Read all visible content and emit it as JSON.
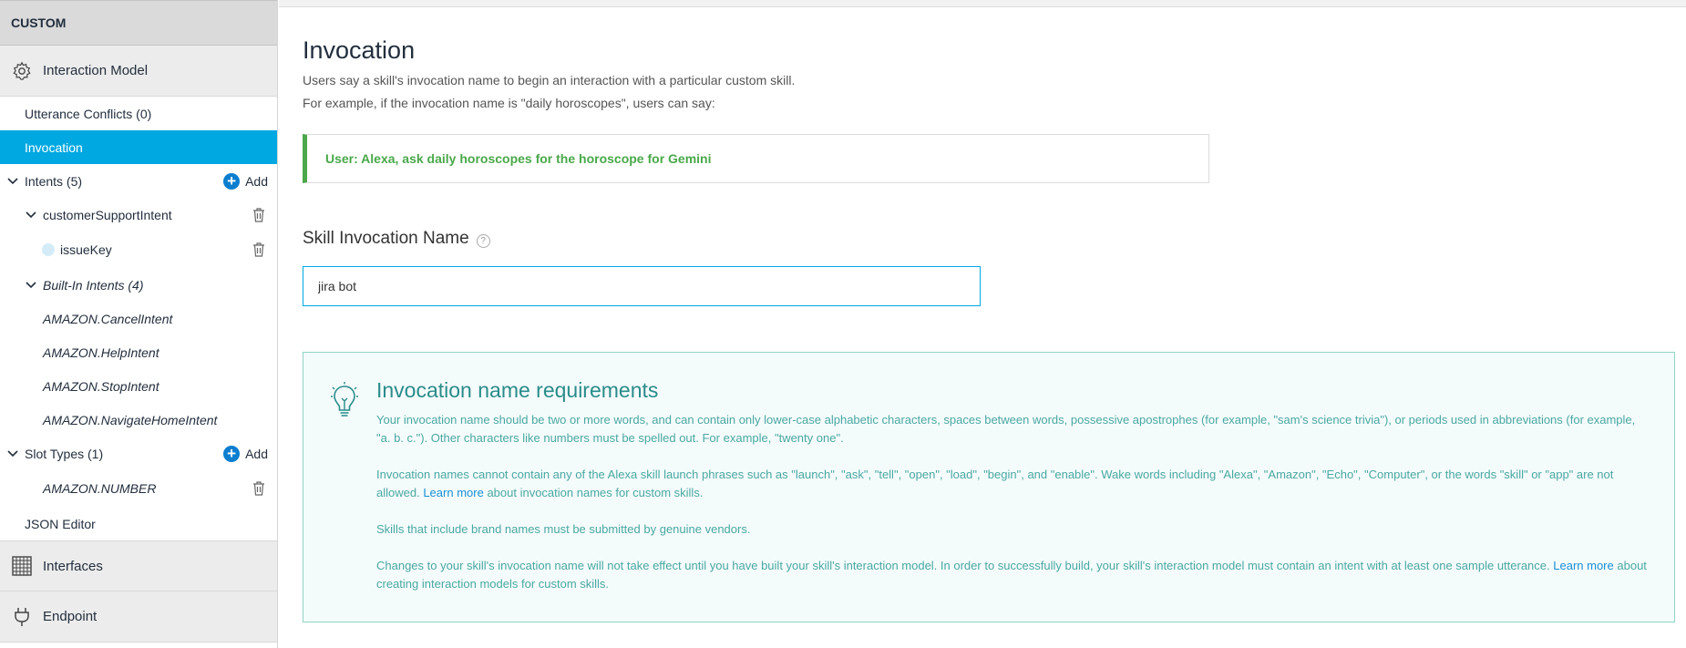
{
  "sidebar": {
    "header": "CUSTOM",
    "interaction_model": {
      "label": "Interaction Model",
      "icon": "gear-icon"
    },
    "utterance_conflicts": "Utterance Conflicts (0)",
    "invocation": "Invocation",
    "intents": {
      "label": "Intents (5)",
      "add": "Add"
    },
    "custom_intent": "customerSupportIntent",
    "slot": "issueKey",
    "builtin_intents": "Built-In Intents (4)",
    "builtin_items": [
      "AMAZON.CancelIntent",
      "AMAZON.HelpIntent",
      "AMAZON.StopIntent",
      "AMAZON.NavigateHomeIntent"
    ],
    "slot_types": {
      "label": "Slot Types (1)",
      "add": "Add"
    },
    "slot_type_item": "AMAZON.NUMBER",
    "json_editor": "JSON Editor",
    "interfaces": {
      "label": "Interfaces",
      "icon": "grid-icon"
    },
    "endpoint": {
      "label": "Endpoint",
      "icon": "plug-icon"
    }
  },
  "main": {
    "title": "Invocation",
    "desc1": "Users say a skill's invocation name to begin an interaction with a particular custom skill.",
    "desc2": "For example, if the invocation name is \"daily horoscopes\", users can say:",
    "example": "User: Alexa, ask daily horoscopes for the horoscope for Gemini",
    "skill_label": "Skill Invocation Name",
    "skill_value": "jira bot",
    "requirements": {
      "title": "Invocation name requirements",
      "p1": "Your invocation name should be two or more words, and can contain only lower-case alphabetic characters, spaces between words, possessive apostrophes (for example, \"sam's science trivia\"), or periods used in abbreviations (for example, \"a. b. c.\"). Other characters like numbers must be spelled out. For example, \"twenty one\".",
      "p2_pre": "Invocation names cannot contain any of the Alexa skill launch phrases such as \"launch\", \"ask\", \"tell\", \"open\", \"load\", \"begin\", and \"enable\". Wake words including \"Alexa\", \"Amazon\", \"Echo\", \"Computer\", or the words \"skill\" or \"app\" are not allowed.",
      "p2_link": "Learn more",
      "p2_post": "about invocation names for custom skills.",
      "p3": "Skills that include brand names must be submitted by genuine vendors.",
      "p4_pre": "Changes to your skill's invocation name will not take effect until you have built your skill's interaction model. In order to successfully build, your skill's interaction model must contain an intent with at least one sample utterance.",
      "p4_link": "Learn more",
      "p4_post": "about creating interaction models for custom skills."
    }
  },
  "colors": {
    "accent": "#00a8e1",
    "example_green": "#4aa84a",
    "req_teal": "#2a8c8a"
  }
}
